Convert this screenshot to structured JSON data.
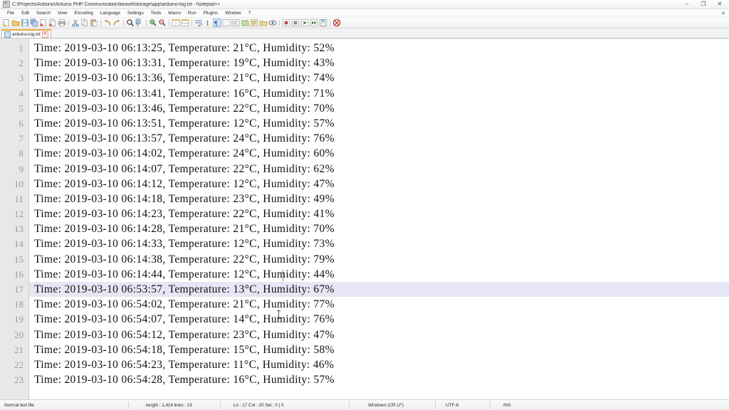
{
  "window": {
    "title": "C:\\Projects\\Arduino\\Arduino PHP Communication\\laravel\\storage\\app\\arduino-log.txt - Notepad++",
    "app_icon": "notepad-plus-plus-icon",
    "minimize": "–",
    "maximize": "❐",
    "close": "✕",
    "doc_close": "✕"
  },
  "menu": {
    "items": [
      {
        "label": "File"
      },
      {
        "label": "Edit"
      },
      {
        "label": "Search"
      },
      {
        "label": "View"
      },
      {
        "label": "Encoding"
      },
      {
        "label": "Language"
      },
      {
        "label": "Settings"
      },
      {
        "label": "Tools"
      },
      {
        "label": "Macro"
      },
      {
        "label": "Run"
      },
      {
        "label": "Plugins"
      },
      {
        "label": "Window"
      },
      {
        "label": "?"
      }
    ]
  },
  "toolbar": {
    "icons": [
      {
        "name": "new-file-icon"
      },
      {
        "name": "open-file-icon"
      },
      {
        "name": "save-icon"
      },
      {
        "name": "save-all-icon"
      },
      {
        "name": "close-file-icon"
      },
      {
        "name": "close-all-files-icon"
      },
      {
        "name": "print-icon"
      },
      {
        "name": "cut-icon"
      },
      {
        "name": "copy-icon"
      },
      {
        "name": "paste-icon"
      },
      {
        "name": "undo-icon"
      },
      {
        "name": "redo-icon"
      },
      {
        "name": "find-icon"
      },
      {
        "name": "replace-icon"
      },
      {
        "name": "zoom-in-icon"
      },
      {
        "name": "zoom-out-icon"
      },
      {
        "name": "sync-vertical-scroll-icon"
      },
      {
        "name": "sync-horizontal-scroll-icon"
      },
      {
        "name": "word-wrap-icon"
      },
      {
        "name": "show-all-characters-icon"
      },
      {
        "name": "indent-guide-icon"
      },
      {
        "name": "user-defined-language-icon"
      },
      {
        "name": "show-document-map-icon"
      },
      {
        "name": "function-list-icon"
      },
      {
        "name": "folder-as-workspace-icon"
      },
      {
        "name": "monitoring-icon"
      },
      {
        "name": "record-macro-icon"
      },
      {
        "name": "stop-recording-macro-icon"
      },
      {
        "name": "playback-macro-icon"
      },
      {
        "name": "run-macro-multiple-times-icon"
      },
      {
        "name": "save-current-macro-icon"
      },
      {
        "name": "run-icon"
      }
    ]
  },
  "tab": {
    "label": "arduino-log.txt",
    "icon": "text-file-icon"
  },
  "editor": {
    "current_line": 17,
    "highlight_color": "#e6e6f5",
    "gutter_color": "#e8e8e8",
    "lines": [
      {
        "num": "1",
        "text": "Time: 2019-03-10 06:13:25, Temperature: 21°C, Humidity: 52%"
      },
      {
        "num": "2",
        "text": "Time: 2019-03-10 06:13:31, Temperature: 19°C, Humidity: 43%"
      },
      {
        "num": "3",
        "text": "Time: 2019-03-10 06:13:36, Temperature: 21°C, Humidity: 74%"
      },
      {
        "num": "4",
        "text": "Time: 2019-03-10 06:13:41, Temperature: 16°C, Humidity: 71%"
      },
      {
        "num": "5",
        "text": "Time: 2019-03-10 06:13:46, Temperature: 22°C, Humidity: 70%"
      },
      {
        "num": "6",
        "text": "Time: 2019-03-10 06:13:51, Temperature: 12°C, Humidity: 57%"
      },
      {
        "num": "7",
        "text": "Time: 2019-03-10 06:13:57, Temperature: 24°C, Humidity: 76%"
      },
      {
        "num": "8",
        "text": "Time: 2019-03-10 06:14:02, Temperature: 24°C, Humidity: 60%"
      },
      {
        "num": "9",
        "text": "Time: 2019-03-10 06:14:07, Temperature: 22°C, Humidity: 62%"
      },
      {
        "num": "10",
        "text": "Time: 2019-03-10 06:14:12, Temperature: 12°C, Humidity: 47%"
      },
      {
        "num": "11",
        "text": "Time: 2019-03-10 06:14:18, Temperature: 23°C, Humidity: 49%"
      },
      {
        "num": "12",
        "text": "Time: 2019-03-10 06:14:23, Temperature: 22°C, Humidity: 41%"
      },
      {
        "num": "13",
        "text": "Time: 2019-03-10 06:14:28, Temperature: 21°C, Humidity: 70%"
      },
      {
        "num": "14",
        "text": "Time: 2019-03-10 06:14:33, Temperature: 12°C, Humidity: 73%"
      },
      {
        "num": "15",
        "text": "Time: 2019-03-10 06:14:38, Temperature: 22°C, Humidity: 79%"
      },
      {
        "num": "16",
        "text": "Time: 2019-03-10 06:14:44, Temperature: 12°C, Humidity: 44%"
      },
      {
        "num": "17",
        "text": "Time: 2019-03-10 06:53:57, Temperature: 13°C, Humidity: 67%"
      },
      {
        "num": "18",
        "text": "Time: 2019-03-10 06:54:02, Temperature: 21°C, Humidity: 77%"
      },
      {
        "num": "19",
        "text": "Time: 2019-03-10 06:54:07, Temperature: 14°C, Humidity: 76%"
      },
      {
        "num": "20",
        "text": "Time: 2019-03-10 06:54:12, Temperature: 23°C, Humidity: 47%"
      },
      {
        "num": "21",
        "text": "Time: 2019-03-10 06:54:18, Temperature: 15°C, Humidity: 58%"
      },
      {
        "num": "22",
        "text": "Time: 2019-03-10 06:54:23, Temperature: 11°C, Humidity: 46%"
      },
      {
        "num": "23",
        "text": "Time: 2019-03-10 06:54:28, Temperature: 16°C, Humidity: 57%"
      }
    ]
  },
  "statusbar": {
    "filetype": "Normal text file",
    "length_lines": "length : 1,424   lines : 23",
    "position": "Ln : 17   Col : 20   Sel : 0 | 0",
    "eol": "Windows (CR LF)",
    "encoding": "UTF-8",
    "insert_mode": "INS"
  }
}
